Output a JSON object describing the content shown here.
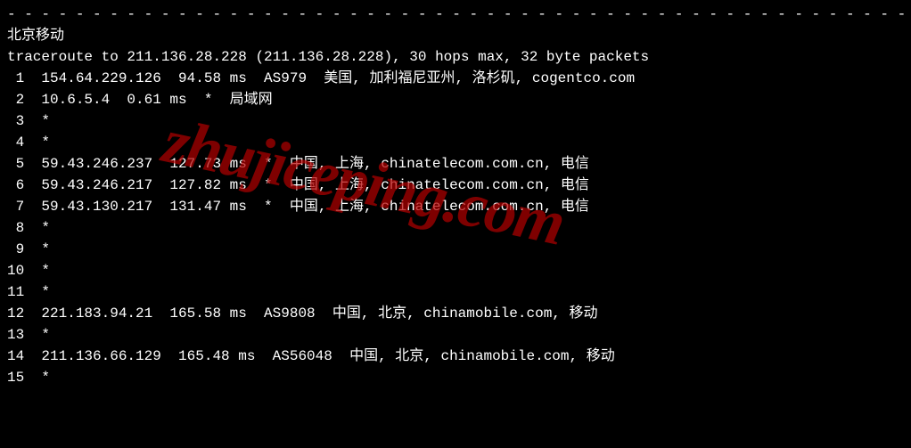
{
  "divider": "- - - - - - - - - - - - - - - - - - - - - - - - - - - - - - - - - - - - - - - - - - - - - - - - - - - - - - - - - - - -",
  "header": "北京移动",
  "trace_header": "traceroute to 211.136.28.228 (211.136.28.228), 30 hops max, 32 byte packets",
  "hops": [
    {
      "n": " 1",
      "text": "  154.64.229.126  94.58 ms  AS979  美国, 加利福尼亚州, 洛杉矶, cogentco.com"
    },
    {
      "n": " 2",
      "text": "  10.6.5.4  0.61 ms  *  局域网"
    },
    {
      "n": " 3",
      "text": "  *"
    },
    {
      "n": " 4",
      "text": "  *"
    },
    {
      "n": " 5",
      "text": "  59.43.246.237  127.73 ms  *  中国, 上海, chinatelecom.com.cn, 电信"
    },
    {
      "n": " 6",
      "text": "  59.43.246.217  127.82 ms  *  中国, 上海, chinatelecom.com.cn, 电信"
    },
    {
      "n": " 7",
      "text": "  59.43.130.217  131.47 ms  *  中国, 上海, chinatelecom.com.cn, 电信"
    },
    {
      "n": " 8",
      "text": "  *"
    },
    {
      "n": " 9",
      "text": "  *"
    },
    {
      "n": "10",
      "text": "  *"
    },
    {
      "n": "11",
      "text": "  *"
    },
    {
      "n": "12",
      "text": "  221.183.94.21  165.58 ms  AS9808  中国, 北京, chinamobile.com, 移动"
    },
    {
      "n": "13",
      "text": "  *"
    },
    {
      "n": "14",
      "text": "  211.136.66.129  165.48 ms  AS56048  中国, 北京, chinamobile.com, 移动"
    },
    {
      "n": "15",
      "text": "  *"
    }
  ],
  "watermark": "zhujiceping.com"
}
